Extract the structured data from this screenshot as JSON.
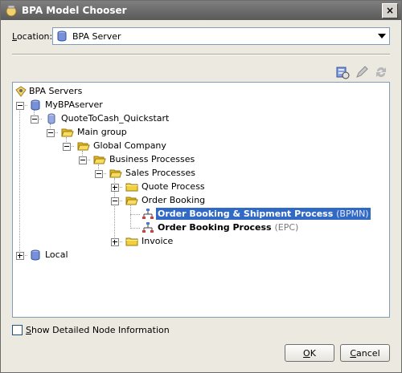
{
  "window": {
    "title": "BPA Model Chooser",
    "close_glyph": "×"
  },
  "location": {
    "label_prefix": "L",
    "label_rest": "ocation:",
    "value": "BPA Server"
  },
  "toolbar": {
    "icons": [
      "server-refresh-icon",
      "edit-icon",
      "refresh-icon"
    ]
  },
  "tree": {
    "root": "BPA Servers",
    "server": "MyBPAserver",
    "repository": "QuoteToCash_Quickstart",
    "main_group": "Main group",
    "global_company": "Global Company",
    "business_processes": "Business Processes",
    "sales_processes": "Sales Processes",
    "quote_process": "Quote Process",
    "order_booking": "Order Booking",
    "model1_name": "Order Booking & Shipment Process",
    "model1_type": "(BPMN)",
    "model2_name": "Order Booking Process",
    "model2_type": "(EPC)",
    "invoice": "Invoice",
    "local": "Local"
  },
  "options": {
    "detailed_prefix": "S",
    "detailed_rest": "how Detailed Node Information",
    "checked": false
  },
  "buttons": {
    "ok_prefix": "O",
    "ok_rest": "K",
    "cancel_prefix": "C",
    "cancel_rest": "ancel"
  },
  "colors": {
    "selection": "#316ac5",
    "titlebar": "#6b6b6b",
    "folder": "#f2cf3c"
  }
}
